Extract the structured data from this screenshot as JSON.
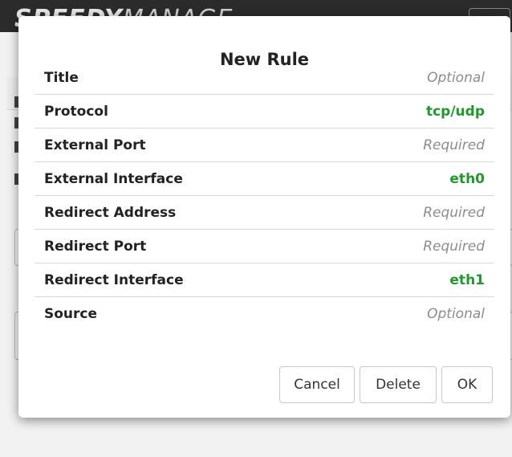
{
  "app": {
    "logo_bold": "SPEEDY",
    "logo_light": "MANAGE"
  },
  "modal": {
    "title": "New Rule",
    "rows": [
      {
        "label": "Title",
        "value": "Optional",
        "kind": "placeholder"
      },
      {
        "label": "Protocol",
        "value": "tcp/udp",
        "kind": "set"
      },
      {
        "label": "External Port",
        "value": "Required",
        "kind": "placeholder"
      },
      {
        "label": "External Interface",
        "value": "eth0",
        "kind": "set"
      },
      {
        "label": "Redirect Address",
        "value": "Required",
        "kind": "placeholder"
      },
      {
        "label": "Redirect Port",
        "value": "Required",
        "kind": "placeholder"
      },
      {
        "label": "Redirect Interface",
        "value": "eth1",
        "kind": "set"
      },
      {
        "label": "Source",
        "value": "Optional",
        "kind": "placeholder"
      }
    ],
    "buttons": {
      "cancel": "Cancel",
      "delete": "Delete",
      "ok": "OK"
    }
  },
  "colors": {
    "set_value": "#1f9a2a",
    "placeholder": "#8c8c8c"
  }
}
